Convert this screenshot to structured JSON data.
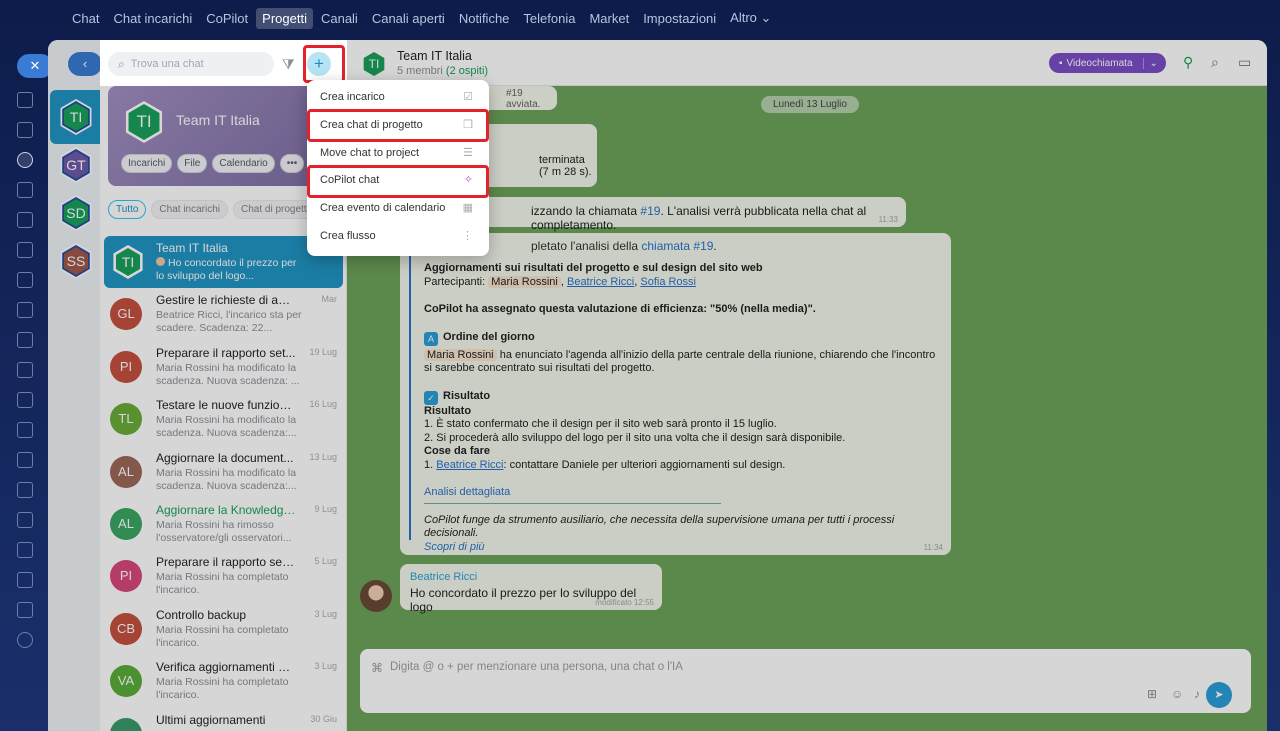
{
  "topnav": [
    "Chat",
    "Chat incarichi",
    "CoPilot",
    "Progetti",
    "Canali",
    "Canali aperti",
    "Notifiche",
    "Telefonia",
    "Market",
    "Impostazioni",
    "Altro ⌄"
  ],
  "topnav_active": 3,
  "search": {
    "placeholder": "Trova una chat"
  },
  "project_card": {
    "initials": "TI",
    "title": "Team IT Italia",
    "chips": [
      "Incarichi",
      "File",
      "Calendario",
      "•••"
    ]
  },
  "filters": [
    "Tutto",
    "Chat incarichi",
    "Chat di progetto"
  ],
  "projects": [
    {
      "initials": "TI",
      "color": "#1aa05b"
    },
    {
      "initials": "GT",
      "color": "#6e5aa8"
    },
    {
      "initials": "SD",
      "color": "#1aa05b"
    },
    {
      "initials": "SS",
      "color": "#a05a4a"
    }
  ],
  "chats": [
    {
      "initials": "TI",
      "color": "#1aa05b",
      "name": "Team IT Italia",
      "date": "",
      "preview": "Ho concordato il prezzo per lo sviluppo del logo...",
      "selected": true
    },
    {
      "initials": "GL",
      "color": "#c5503f",
      "name": "Gestire le richieste di assis...",
      "date": "Mar",
      "preview": "Beatrice Ricci, l'incarico sta per scadere. Scadenza: 22..."
    },
    {
      "initials": "PI",
      "color": "#c5503f",
      "name": "Preparare il rapporto set...",
      "date": "19 Lug",
      "preview": "Maria Rossini ha modificato la scadenza. Nuova scadenza: ..."
    },
    {
      "initials": "TL",
      "color": "#6aad3a",
      "name": "Testare le nuove funzion...",
      "date": "16 Lug",
      "preview": "Maria Rossini ha modificato la scadenza. Nuova scadenza:..."
    },
    {
      "initials": "AL",
      "color": "#9c6858",
      "name": "Aggiornare la document...",
      "date": "13 Lug",
      "preview": "Maria Rossini ha modificato la scadenza. Nuova scadenza:..."
    },
    {
      "initials": "AL",
      "color": "#3aa764",
      "name": "Aggiornare la Knowledge ...",
      "date": "9 Lug",
      "preview": "Maria Rossini ha rimosso l'osservatore/gli osservatori...",
      "green": true
    },
    {
      "initials": "PI",
      "color": "#d8487d",
      "name": "Preparare il rapporto setti...",
      "date": "5 Lug",
      "preview": "Maria Rossini ha completato l'incarico."
    },
    {
      "initials": "CB",
      "color": "#c5503f",
      "name": "Controllo backup",
      "date": "3 Lug",
      "preview": "Maria Rossini ha completato l'incarico."
    },
    {
      "initials": "VA",
      "color": "#5aad3a",
      "name": "Verifica aggiornamenti di ...",
      "date": "3 Lug",
      "preview": "Maria Rossini ha completato l'incarico."
    },
    {
      "initials": "",
      "color": "#3a9a6a",
      "name": "Ultimi aggiornamenti",
      "date": "30 Giu",
      "preview": ""
    }
  ],
  "header": {
    "initials": "TI",
    "title": "Team IT Italia",
    "members": "5 membri",
    "guests": "(2 ospiti)",
    "video_label": "Videochiamata"
  },
  "messages": {
    "top_snippet": "#19 avviata.",
    "date": "Lunedì 13 Luglio",
    "call_ended": "terminata (7 m 28 s).",
    "analyzing_pre": "izzando la chiamata ",
    "analyzing_link": "#19",
    "analyzing_post": ". L'analisi verrà pubblicata nella chat al completamento.",
    "analyzing_time": "11:33",
    "done_pre": "pletato l'analisi della ",
    "done_link": "chiamata #19",
    "done_post": ".",
    "report_title": "Aggiornamenti sui risultati del progetto e sul design del sito web",
    "participants_label": "Partecipanti:",
    "participants": [
      "Maria Rossini",
      "Beatrice Ricci",
      "Sofia Rossi"
    ],
    "efficiency": "CoPilot ha assegnato questa valutazione di efficienza: \"50% (nella media)\".",
    "agenda_title": "Ordine del giorno",
    "agenda_mention": "Maria Rossini",
    "agenda_text": " ha enunciato l'agenda all'inizio della parte centrale della riunione, chiarendo che l'incontro si sarebbe concentrato sui risultati del progetto.",
    "result_title": "Risultato",
    "result_sub": "Risultato",
    "result_items": [
      "1. È stato confermato che il design per il sito web sarà pronto il 15 luglio.",
      "2. Si procederà allo sviluppo del logo per il sito una volta che il design sarà disponibile."
    ],
    "todo_title": "Cose da fare",
    "todo_prefix": "1. ",
    "todo_mention": "Beatrice Ricci",
    "todo_text": ": contattare Daniele per ulteriori aggiornamenti sul design.",
    "detail_link": "Analisi dettagliata",
    "disclaimer": "CoPilot funge da strumento ausiliario, che necessita della supervisione umana per tutti i processi decisionali.",
    "learn_more": "Scopri di più",
    "report_time": "11:34",
    "last_author": "Beatrice Ricci",
    "last_text": "Ho concordato il prezzo per lo sviluppo del logo",
    "last_time": "modificato 12:55"
  },
  "composer": {
    "placeholder": "Digita @ o + per menzionare una persona, una chat o l'IA"
  },
  "menu": [
    {
      "label": "Crea incarico",
      "icon": "task-icon"
    },
    {
      "label": "Crea chat di progetto",
      "icon": "chat-icon"
    },
    {
      "label": "Move chat to project",
      "icon": "move-icon"
    },
    {
      "label": "CoPilot chat",
      "icon": "copilot-icon"
    },
    {
      "label": "Crea evento di calendario",
      "icon": "calendar-icon"
    },
    {
      "label": "Crea flusso",
      "icon": "flow-icon"
    }
  ]
}
